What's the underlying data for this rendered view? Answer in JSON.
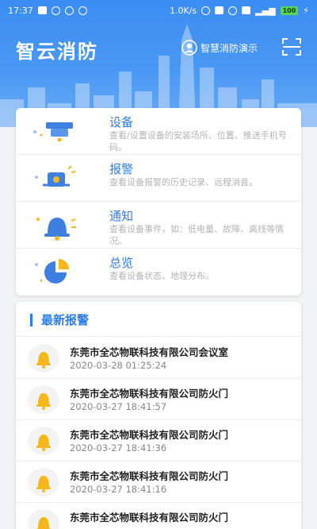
{
  "status_bar": {
    "time": "17:37",
    "speed": "1.0K/s",
    "battery": "100"
  },
  "header": {
    "app_title": "智云消防",
    "user_label": "智慧消防演示"
  },
  "menu": [
    {
      "title": "设备",
      "desc": "查看/设置设备的安装场所、位置、推送手机号码。",
      "icon": "detector-icon"
    },
    {
      "title": "报警",
      "desc": "查看设备报警的历史记录、远程消音。",
      "icon": "siren-icon"
    },
    {
      "title": "通知",
      "desc": "查看设备事件，如：低电量、故障、离线等情况。",
      "icon": "bell-icon"
    },
    {
      "title": "总览",
      "desc": "查看设备状态、地理分布。",
      "icon": "pie-icon"
    }
  ],
  "alarms": {
    "section_title": "最新报警",
    "items": [
      {
        "name": "东莞市全芯物联科技有限公司会议室",
        "time": "2020-03-28 01:25:24"
      },
      {
        "name": "东莞市全芯物联科技有限公司防火门",
        "time": "2020-03-27 18:41:57"
      },
      {
        "name": "东莞市全芯物联科技有限公司防火门",
        "time": "2020-03-27 18:41:36"
      },
      {
        "name": "东莞市全芯物联科技有限公司防火门",
        "time": "2020-03-27 18:41:16"
      },
      {
        "name": "东莞市全芯物联科技有限公司防火门",
        "time": ""
      }
    ]
  },
  "colors": {
    "brand_blue": "#3b8df2",
    "accent_blue": "#2b7de9",
    "bell_yellow": "#f5b71b"
  }
}
